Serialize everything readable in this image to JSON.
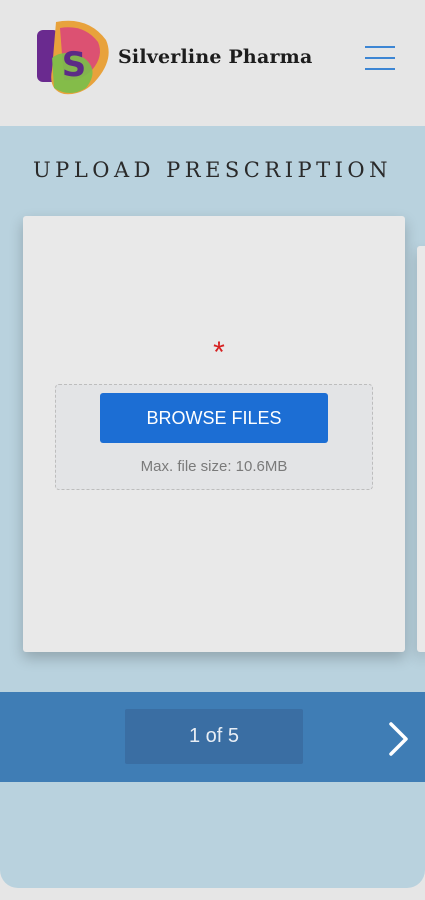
{
  "header": {
    "brand_name": "Silverline Pharma",
    "logo_letter": "S",
    "menu_icon": "hamburger-menu-icon"
  },
  "upload": {
    "title": "UPLOAD PRESCRIPTION",
    "required_marker": "*",
    "browse_label": "BROWSE FILES",
    "max_file_size": "Max. file size: 10.6MB"
  },
  "pager": {
    "indicator": "1 of 5",
    "next_icon": "chevron-right-icon"
  },
  "colors": {
    "accent": "#1c6ed4",
    "pager_bg": "#3f7db5",
    "panel_bg": "#b9d2de",
    "required": "#d62020"
  }
}
